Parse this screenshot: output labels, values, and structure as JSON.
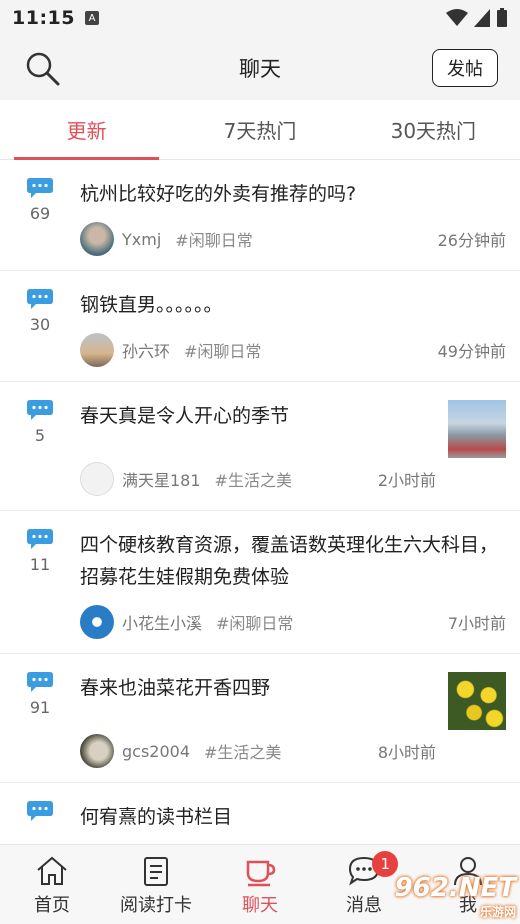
{
  "status": {
    "time": "11:15"
  },
  "header": {
    "title": "聊天",
    "post_button": "发帖"
  },
  "tabs": [
    "更新",
    "7天热门",
    "30天热门"
  ],
  "posts": [
    {
      "count": "69",
      "text": "杭州比较好吃的外卖有推荐的吗?",
      "author": "Yxmj",
      "tag": "#闲聊日常",
      "time": "26分钟前"
    },
    {
      "count": "30",
      "text": "钢铁直男。。。。。。",
      "author": "孙六环",
      "tag": "#闲聊日常",
      "time": "49分钟前"
    },
    {
      "count": "5",
      "text": "春天真是令人开心的季节",
      "author": "满天星181",
      "tag": "#生活之美",
      "time": "2小时前"
    },
    {
      "count": "11",
      "text": "四个硬核教育资源，覆盖语数英理化生六大科目，招募花生娃假期免费体验",
      "author": "小花生小溪",
      "tag": "#闲聊日常",
      "time": "7小时前"
    },
    {
      "count": "91",
      "text": "春来也油菜花开香四野",
      "author": "gcs2004",
      "tag": "#生活之美",
      "time": "8小时前"
    },
    {
      "count": "",
      "text": "何宥熹的读书栏目",
      "author": "",
      "tag": "",
      "time": ""
    }
  ],
  "tabbar": {
    "home": "首页",
    "reading": "阅读打卡",
    "chat": "聊天",
    "messages": "消息",
    "messages_badge": "1",
    "me": "我"
  },
  "watermark": {
    "main": "962.NET",
    "sub": "乐游网"
  },
  "colors": {
    "accent": "#e0505a",
    "bubble": "#3b9de0",
    "badge": "#e84040"
  }
}
